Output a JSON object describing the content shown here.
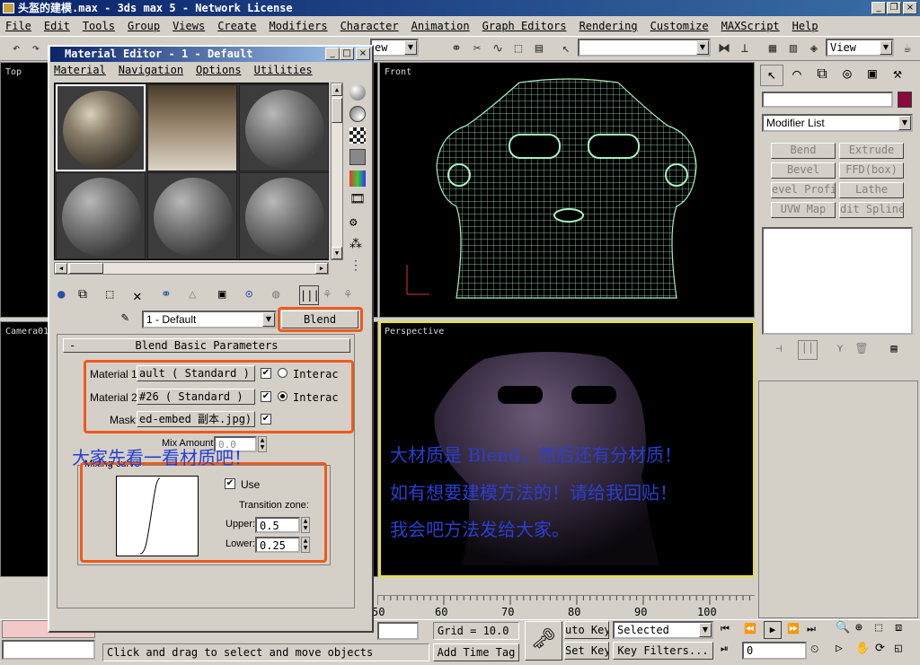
{
  "app": {
    "title": "头盔的建模.max - 3ds max 5 - Network License",
    "controls": {
      "minimize": "_",
      "restore": "❐",
      "close": "×"
    }
  },
  "menu": [
    "File",
    "Edit",
    "Tools",
    "Group",
    "Views",
    "Create",
    "Modifiers",
    "Character",
    "Animation",
    "Graph Editors",
    "Rendering",
    "Customize",
    "MAXScript",
    "Help"
  ],
  "toolbar": {
    "view_dropdown": "View",
    "partial_dropdown": "ew"
  },
  "viewports": {
    "top": "Top",
    "front": "Front",
    "camera": "Camera01",
    "perspective": "Perspective"
  },
  "command_panel": {
    "modifier_list": "Modifier List",
    "buttons": [
      "Bend",
      "Extrude",
      "Bevel",
      "FFD(box)",
      "evel Profi",
      "Lathe",
      "UVW Map",
      "dit Spline"
    ]
  },
  "material_editor": {
    "title": "Material Editor - 1 - Default",
    "menu": [
      "Material",
      "Navigation",
      "Options",
      "Utilities"
    ],
    "material_name": "1 - Default",
    "type_button": "Blend",
    "rollout": {
      "collapse": "-",
      "title": "Blend Basic Parameters"
    },
    "material1": {
      "label": "Material 1:",
      "value": "ault  ( Standard )",
      "interactive": "Interac"
    },
    "material2": {
      "label": "Material 2:",
      "value": "#26  ( Standard )",
      "interactive": "Interac"
    },
    "mask": {
      "label": "Mask:",
      "value": "ed-embed 副本.jpg)"
    },
    "mix_amount": {
      "label": "Mix Amount:",
      "value": "0.0"
    },
    "mixing_curve": {
      "title": "Mixing curve",
      "use": "Use",
      "transition": "Transition zone:",
      "upper_label": "Upper:",
      "upper": "0.5",
      "lower_label": "Lower:",
      "lower": "0.25"
    }
  },
  "annotations": {
    "left": "大家先看一看材质吧！",
    "right": [
      "大材质是 Blend，然后还有分材质！",
      "如有想要建模方法的！请给我回贴！",
      "我会吧方法发给大家。"
    ]
  },
  "timeline": {
    "ticks": [
      "50",
      "60",
      "70",
      "80",
      "90",
      "100"
    ]
  },
  "status": {
    "grid": "Grid = 10.0",
    "add_time_tag": "Add Time Tag",
    "prompt": "Click and drag to select and move objects",
    "auto_key": "uto Key",
    "set_key": "Set Key",
    "selected": "Selected",
    "key_filters": "Key Filters...",
    "frame": "0",
    "coord": "0"
  },
  "colors": {
    "title": "#0a246a",
    "orange": "#ee5a1c",
    "annotation": "#2a3fd0",
    "wire": "#a8f0c0",
    "active_viewport": "#f0e020"
  }
}
